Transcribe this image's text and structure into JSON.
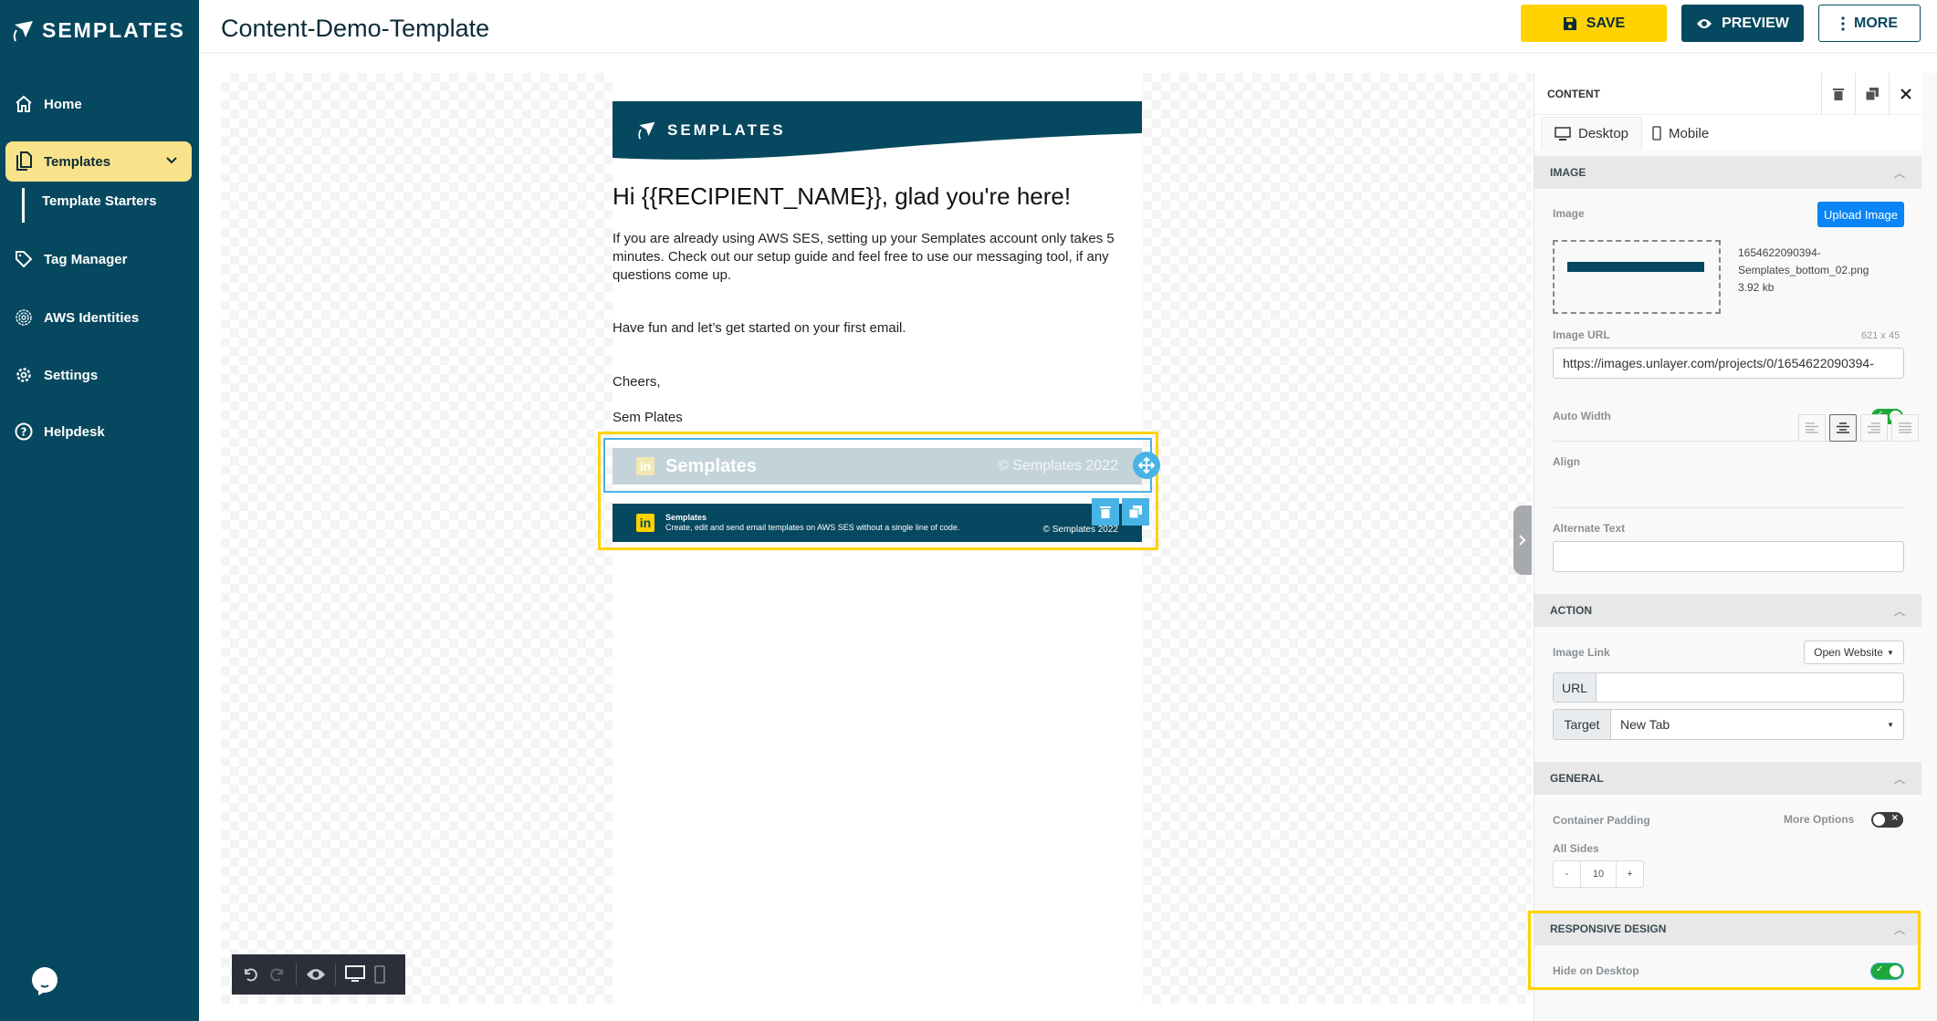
{
  "sidebar": {
    "brand": "SEMPLATES",
    "items": [
      {
        "label": "Home",
        "icon": "home-icon"
      },
      {
        "label": "Templates",
        "icon": "copy-icon",
        "active": true
      },
      {
        "label": "Tag Manager",
        "icon": "tag-icon"
      },
      {
        "label": "AWS Identities",
        "icon": "fingerprint-icon"
      },
      {
        "label": "Settings",
        "icon": "gear-icon"
      },
      {
        "label": "Helpdesk",
        "icon": "help-circle-icon"
      }
    ],
    "sub_items": [
      {
        "label": "Template Starters"
      }
    ],
    "chat_icon": "chat-icon"
  },
  "header": {
    "title": "Content-Demo-Template",
    "save_label": "SAVE",
    "preview_label": "PREVIEW",
    "more_label": "MORE"
  },
  "email": {
    "brand": "SEMPLATES",
    "greeting": "Hi {{RECIPIENT_NAME}}, glad you're here!",
    "paragraph1": "If you are already using AWS SES, setting up your Semplates account only takes 5 minutes. Check out our setup guide and feel free to use our messaging tool, if any questions come up.",
    "paragraph2": "Have fun and let’s get started on your first email.",
    "closing": "Cheers,",
    "signature": "Sem Plates",
    "footer_hidden": {
      "linkedin": "in",
      "name": "Semplates",
      "copyright": "© Semplates 2022"
    },
    "footer": {
      "linkedin": "in",
      "name": "Semplates",
      "tagline": "Create, edit and send email templates on AWS SES without a single line of code.",
      "copyright": "© Semplates 2022"
    }
  },
  "panel": {
    "title": "CONTENT",
    "device_tabs": [
      {
        "label": "Desktop",
        "active": true
      },
      {
        "label": "Mobile",
        "active": false
      }
    ],
    "image_section": {
      "heading": "IMAGE",
      "image_label": "Image",
      "upload_label": "Upload Image",
      "file_name_line1": "1654622090394-",
      "file_name_line2": "Semplates_bottom_02.png",
      "file_size": "3.92 kb",
      "url_label": "Image URL",
      "dimensions": "621 x 45",
      "url_value": "https://images.unlayer.com/projects/0/1654622090394-",
      "auto_width_label": "Auto Width",
      "auto_width": true,
      "align_label": "Align",
      "align_selected": "center",
      "alt_label": "Alternate Text",
      "alt_value": ""
    },
    "action_section": {
      "heading": "ACTION",
      "link_label": "Image Link",
      "link_type": "Open Website",
      "url_addon": "URL",
      "url_value": "",
      "target_addon": "Target",
      "target_value": "New Tab"
    },
    "general_section": {
      "heading": "GENERAL",
      "padding_label": "Container Padding",
      "more_options_label": "More Options",
      "more_options": false,
      "all_sides_label": "All Sides",
      "minus": "-",
      "padding_value": "10",
      "plus": "+"
    },
    "responsive_section": {
      "heading": "RESPONSIVE DESIGN",
      "hide_desktop_label": "Hide on Desktop",
      "hide_desktop": true
    }
  },
  "colors": {
    "sidebar_bg": "#06485f",
    "accent_yellow": "#ffd200",
    "selection_blue": "#48b4e6",
    "upload_blue": "#0a85f5",
    "toggle_green": "#1ea83a"
  }
}
